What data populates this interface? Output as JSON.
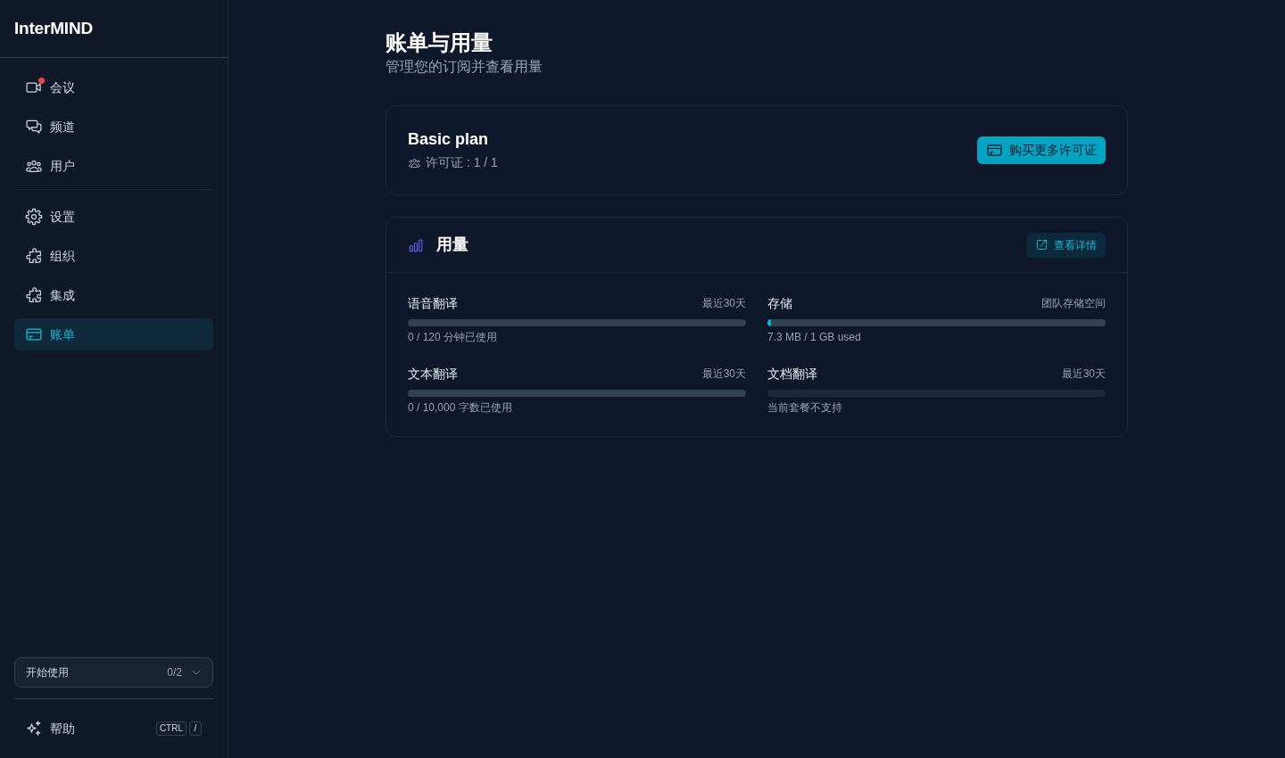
{
  "sidebar": {
    "brand": "InterMIND",
    "nav_sections": [
      {
        "items": [
          {
            "label": "会议",
            "alert": true,
            "selected": false
          },
          {
            "label": "频道",
            "alert": false,
            "selected": false
          },
          {
            "label": "用户",
            "alert": false,
            "selected": false
          }
        ]
      },
      {
        "items": [
          {
            "label": "设置",
            "alert": false,
            "selected": false
          },
          {
            "label": "组织",
            "alert": false,
            "selected": false
          },
          {
            "label": "集成",
            "alert": false,
            "selected": false
          },
          {
            "label": "账单",
            "alert": false,
            "selected": true
          }
        ]
      }
    ],
    "onboarding": {
      "label": "开始使用",
      "progress": "0/2",
      "expanded": false
    },
    "help": {
      "label": "帮助",
      "shortcut": [
        "CTRL",
        "/"
      ]
    }
  },
  "page": {
    "title": "账单与用量",
    "subtitle": "管理您的订阅并查看用量"
  },
  "plan_card": {
    "name": "Basic plan",
    "licenses": "许可证 : 1 / 1",
    "button": "购买更多许可证"
  },
  "usage_card": {
    "title": "用量",
    "button": "查看详情",
    "meters": [
      {
        "label": "语音翻译",
        "period": "最近30天",
        "level": 0,
        "reading": "0 / 120 分钟已使用",
        "disabled": false
      },
      {
        "label": "存储",
        "period": "团队存储空间",
        "level": 0.01,
        "reading": "7.3 MB / 1 GB used",
        "disabled": false
      },
      {
        "label": "文本翻译",
        "period": "最近30天",
        "level": 0,
        "reading": "0 / 10,000 字数已使用",
        "disabled": false
      },
      {
        "label": "文档翻译",
        "period": "最近30天",
        "level": 0,
        "reading": "当前套餐不支持",
        "disabled": true
      }
    ]
  }
}
